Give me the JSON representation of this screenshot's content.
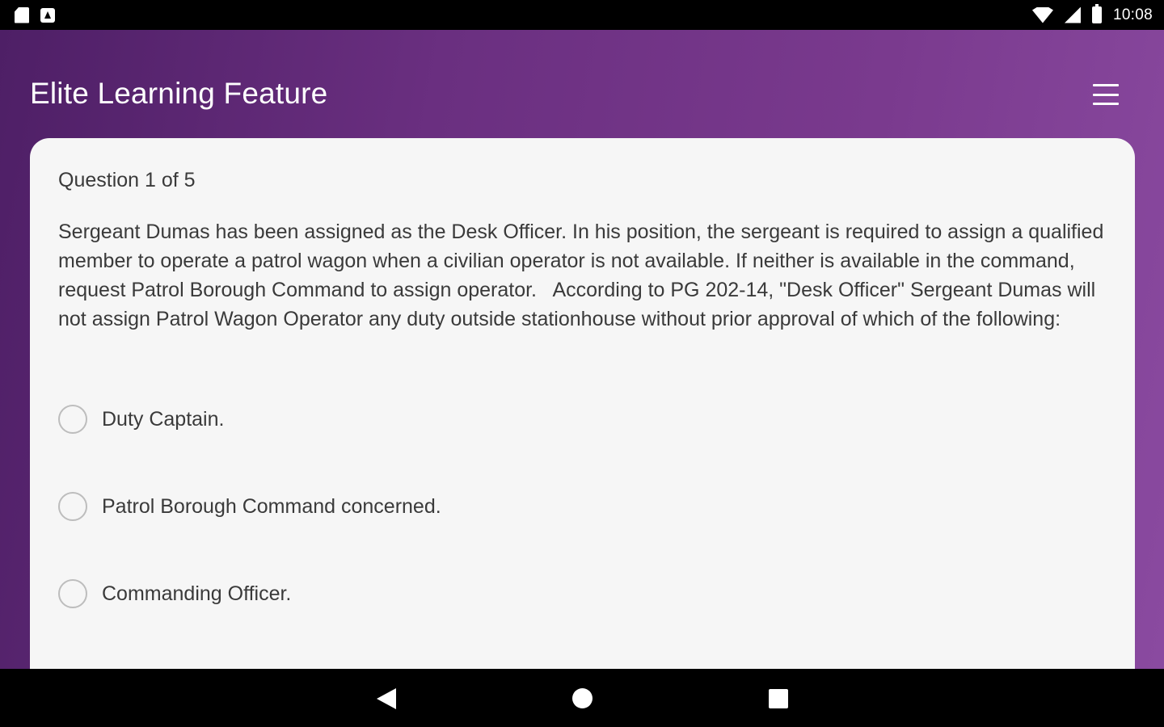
{
  "status_bar": {
    "time": "10:08",
    "icons": [
      "sd-card-icon",
      "app-notification-icon",
      "wifi-icon",
      "cell-signal-icon",
      "battery-icon"
    ]
  },
  "app_bar": {
    "title": "Elite Learning Feature",
    "menu_icon": "hamburger-menu-icon"
  },
  "quiz": {
    "counter": "Question 1 of 5",
    "question": "Sergeant Dumas has been assigned as the Desk Officer. In his position, the sergeant is required to assign a qualified member to operate a patrol wagon when a civilian operator is not available. If neither is available in the command, request Patrol Borough Command to assign operator.   According to PG 202-14, \"Desk Officer\" Sergeant Dumas will not assign Patrol Wagon Operator any duty outside stationhouse without prior approval of which of the following:",
    "options": [
      {
        "label": "Duty Captain."
      },
      {
        "label": "Patrol Borough Command concerned."
      },
      {
        "label": "Commanding Officer."
      }
    ]
  },
  "nav_bar": {
    "icons": [
      "back-icon",
      "home-icon",
      "recents-icon"
    ]
  },
  "colors": {
    "app_bar_start": "#4e1f66",
    "app_bar_end": "#8a4aa0",
    "card_background": "#f6f6f6",
    "text": "#3a3a3a",
    "radio_border": "#bdbdbd"
  }
}
